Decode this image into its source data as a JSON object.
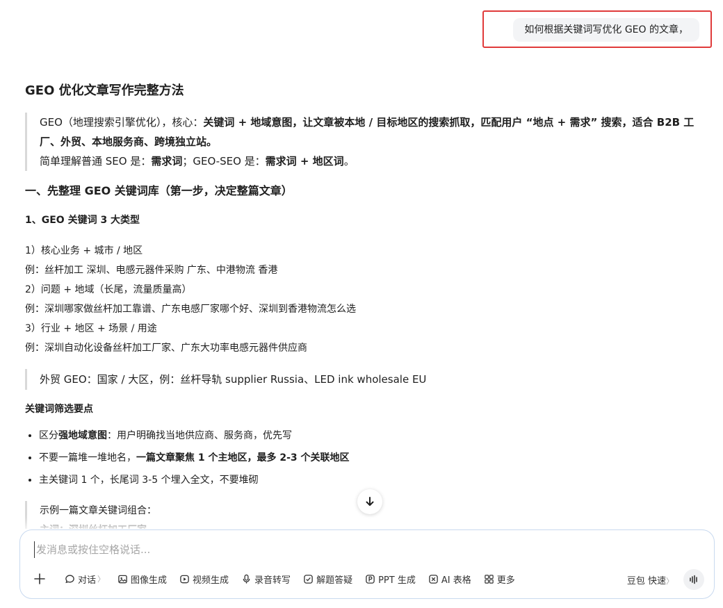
{
  "user_message": "如何根据关键词写优化 GEO 的文章，",
  "answer": {
    "title": "GEO 优化文章写作完整方法",
    "intro": {
      "prefix": "GEO（地理搜索引擎优化），核心：",
      "bold": "关键词 + 地域意图，让文章被本地 / 目标地区的搜索抓取，匹配用户 “地点 + 需求” 搜索，适合 B2B 工厂、外贸、本地服务商、跨境独立站。",
      "line2_prefix": "简单理解普通 SEO 是：",
      "line2_b1": "需求词",
      "line2_mid": "；GEO-SEO 是：",
      "line2_b2": "需求词 + 地区词",
      "line2_end": "。"
    },
    "section1_title": "一、先整理 GEO 关键词库（第一步，决定整篇文章）",
    "sub1_title": "1、GEO 关键词 3 大类型",
    "types": [
      "1）核心业务 + 城市 / 地区",
      "例：丝杆加工 深圳、电感元器件采购 广东、中港物流 香港",
      "2）问题 + 地域（长尾，流量质量高）",
      "例：深圳哪家做丝杆加工靠谱、广东电感厂家哪个好、深圳到香港物流怎么选",
      "3）行业 + 地区 + 场景 / 用途",
      "例：深圳自动化设备丝杆加工厂家、广东大功率电感元器件供应商"
    ],
    "foreign_note": "外贸 GEO：国家 / 大区，例：丝杆导轨 supplier Russia、LED ink wholesale EU",
    "filter_title": "关键词筛选要点",
    "points": {
      "p1_prefix": "区分",
      "p1_bold": "强地域意图",
      "p1_rest": "：用户明确找当地供应商、服务商，优先写",
      "p2_prefix": "不要一篇堆一堆地名，",
      "p2_bold": "一篇文章聚焦 1 个主地区，最多 2-3 个关联地区",
      "p3": "主关键词 1 个，长尾词 3-5 个埋入全文，不要堆砌"
    },
    "example_title": "示例一篇文章关键词组合：",
    "example_cut": "主词：深圳丝杆加工厂家"
  },
  "composer": {
    "placeholder": "发消息或按住空格说话...",
    "tools": {
      "chat": "对话",
      "image": "图像生成",
      "video": "视频生成",
      "audio": "录音转写",
      "solve": "解题答疑",
      "ppt": "PPT 生成",
      "ai_sheet": "AI 表格",
      "more": "更多"
    },
    "model": "豆包 快速"
  }
}
